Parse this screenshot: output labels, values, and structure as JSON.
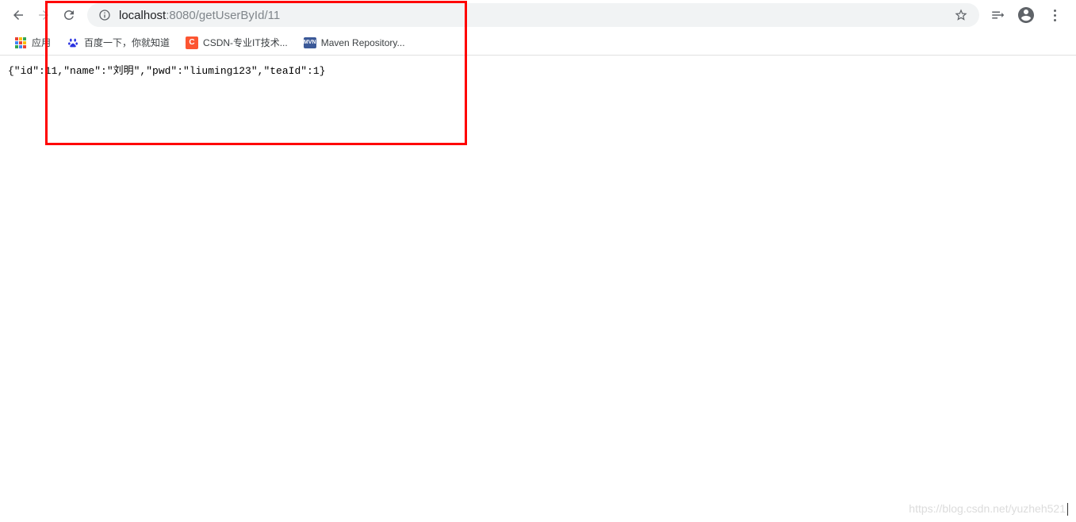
{
  "toolbar": {
    "url_host": "localhost",
    "url_port_path": ":8080/getUserById/11"
  },
  "bookmarks": {
    "apps_label": "应用",
    "items": [
      {
        "label": "百度一下，你就知道"
      },
      {
        "label": "CSDN-专业IT技术..."
      },
      {
        "label": "Maven Repository..."
      }
    ]
  },
  "page": {
    "json_text": "{\"id\":11,\"name\":\"刘明\",\"pwd\":\"liuming123\",\"teaId\":1}"
  },
  "watermark": "https://blog.csdn.net/yuzheh521"
}
